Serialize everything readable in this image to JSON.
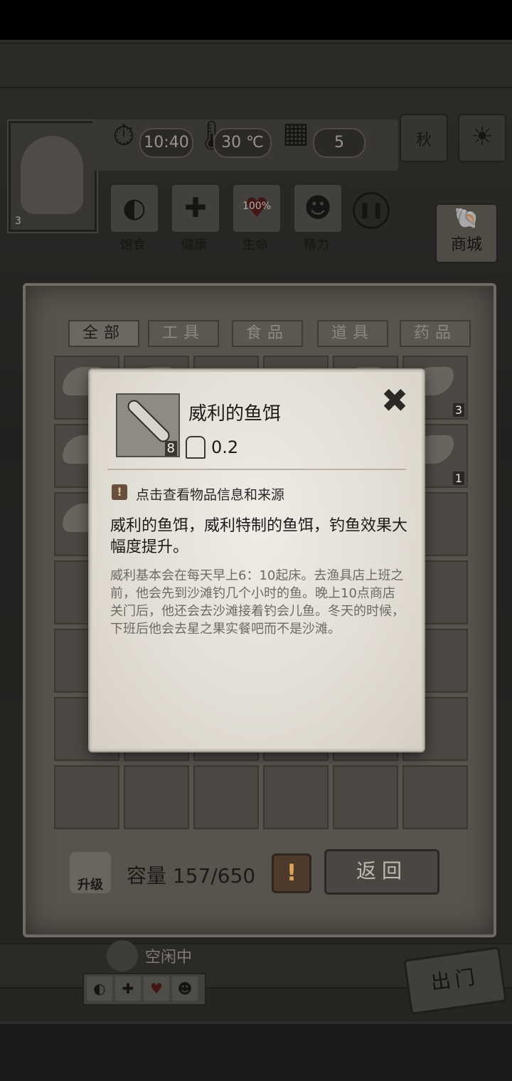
{
  "hud": {
    "time": "10:40",
    "temperature": "30 ℃",
    "day": "5",
    "season": "秋",
    "character_level": "3",
    "stats": [
      {
        "label": "饱食",
        "icon": "stomach-icon"
      },
      {
        "label": "健康",
        "icon": "plus-icon"
      },
      {
        "label": "生命",
        "icon": "heart-icon",
        "value": "100%"
      },
      {
        "label": "精力",
        "icon": "person-icon"
      }
    ],
    "shop_label": "商城",
    "go_out_label": "出门",
    "idle_status": "空闲中"
  },
  "inventory": {
    "tabs": [
      "全部",
      "工具",
      "食品",
      "道具",
      "药品"
    ],
    "active_tab": 0,
    "slot_counts": {
      "slot_6": "3",
      "slot_12": "1"
    },
    "capacity_label": "容量",
    "capacity_value": "157/650",
    "upgrade_label": "升级",
    "back_label": "返回"
  },
  "popup": {
    "item_name": "威利的鱼饵",
    "item_count": "8",
    "weight": "0.2",
    "hint": "点击查看物品信息和来源",
    "description": "威利的鱼饵，威利特制的鱼饵，钓鱼效果大幅度提升。",
    "lore": "威利基本会在每天早上6：10起床。去渔具店上班之前，他会先到沙滩钓几个小时的鱼。晚上10点商店关门后，他还会去沙滩接着钓会儿鱼。冬天的时候，下班后他会去星之果实餐吧而不是沙滩。"
  },
  "colors": {
    "panel": "#57534d",
    "popup_paper": "#e6e2da",
    "alert": "#d9a45a"
  }
}
